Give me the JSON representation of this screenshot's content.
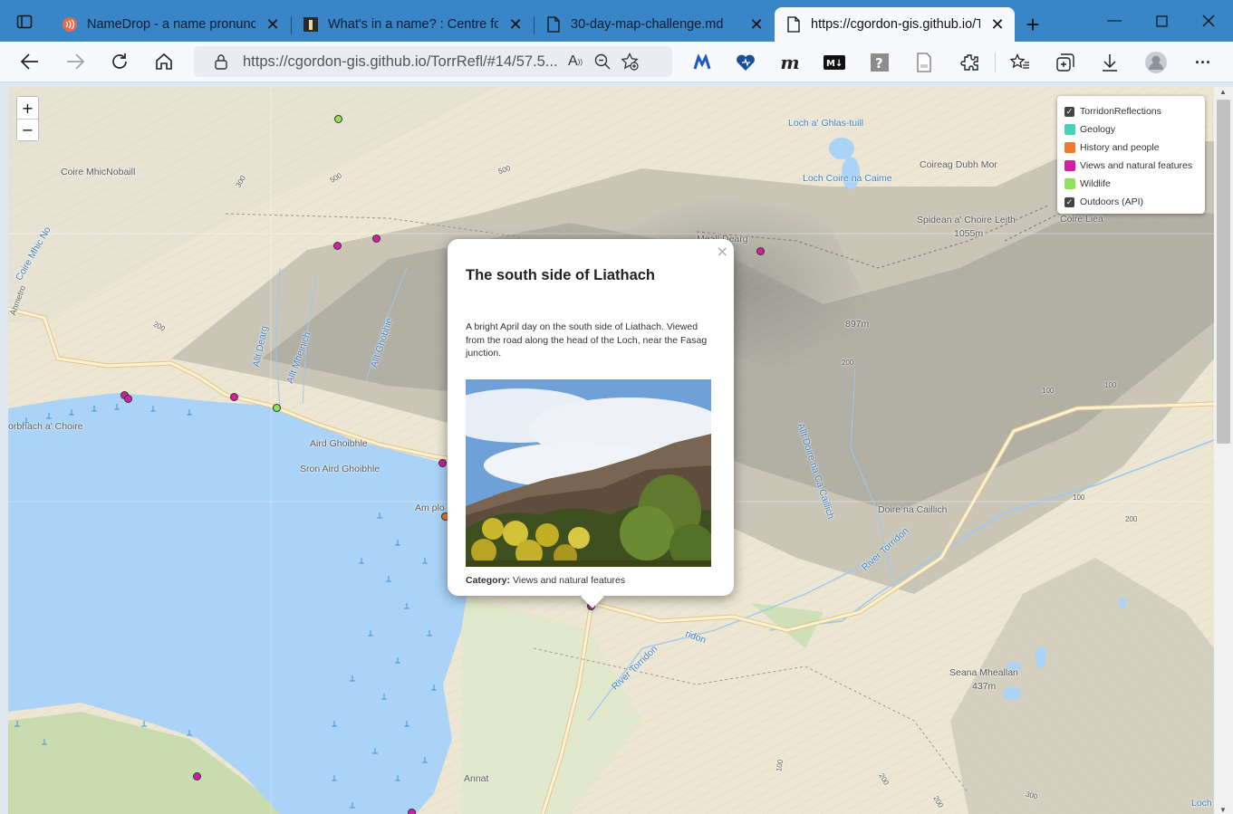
{
  "browser": {
    "tabs": [
      {
        "title": "NameDrop - a name pronunciat",
        "favicon": "namedrop-icon"
      },
      {
        "title": "What's in a name? : Centre for E",
        "favicon": "centre-icon"
      },
      {
        "title": "30-day-map-challenge.md",
        "favicon": "document-icon"
      },
      {
        "title": "https://cgordon-gis.github.io/To",
        "favicon": "document-icon",
        "active": true
      }
    ],
    "address": "https://cgordon-gis.github.io/TorrRefl/#14/57.5...",
    "extensions": [
      "m-extension-icon",
      "heart-extension-icon",
      "italic-m-extension-icon",
      "markdown-extension-icon",
      "help-extension-icon",
      "page-extension-icon"
    ]
  },
  "map": {
    "zoom": {
      "in": "+",
      "out": "−"
    },
    "layers": [
      {
        "label": "TorridonReflections",
        "type": "checkbox",
        "checked": true
      },
      {
        "label": "Geology",
        "type": "swatch",
        "color": "#46d3b9"
      },
      {
        "label": "History and people",
        "type": "swatch",
        "color": "#f07a2c"
      },
      {
        "label": "Views and natural features",
        "type": "swatch",
        "color": "#d21fa6"
      },
      {
        "label": "Wildlife",
        "type": "swatch",
        "color": "#90e35a"
      },
      {
        "label": "Outdoors (API)",
        "type": "checkbox",
        "checked": true
      }
    ],
    "labels": {
      "loch_ghlas": "Loch a' Ghlas-tuill",
      "loch_coire_caime": "Loch Coire na Caime",
      "coire_mhicnobaill": "Coire MhicNobaill",
      "coire_mhic_nobaill2": "Coire Mhic No",
      "coireag_dubh": "Coireag Dubh Mor",
      "spidean": "Spidean a' Choire Leith",
      "spidean_h": "1055m",
      "coire_liea": "Coire Liea",
      "meall_dearg": "Meall Dearg",
      "h897": "897m",
      "allt_doire": "Allt Doire na Ca Caillich",
      "allt_dearg": "Allt Dearg",
      "allt_mheinich": "Allt Mheinich",
      "allt_ghobhie": "Allt Ghobhie",
      "torbhach": "orbhach a' Choire",
      "aird_ghoibhle": "Aird Ghoibhle",
      "sron_aird": "Sron Aird Ghoibhle",
      "am_plo": "Am plo",
      "doire_caillich": "Doire na Caillich",
      "river_torridon1": "River Torridon",
      "river_torridon2": "River Torridon",
      "ridon": "ridon",
      "seana_mheallan": "Seana Mheallan",
      "seana_h": "437m",
      "annat": "Annat",
      "loch_edge": "Loch",
      "c500a": "500",
      "c500b": "500",
      "c300": "300",
      "c200": "200",
      "c100a": "100",
      "c100b": "100",
      "c100c": "100",
      "c200b": "200",
      "c100d": "100",
      "c200c": "200",
      "c200d": "200",
      "c300b": "300",
      "c200e": "200",
      "coire_edge": "Ahmetro"
    },
    "popup": {
      "title": "The south side of Liathach",
      "close": "×",
      "description": "A bright April day on the south side of Liathach. Viewed from the road along the head of the Loch, near the Fasag junction.",
      "category_label": "Category:",
      "category_value": "Views and natural features"
    }
  }
}
